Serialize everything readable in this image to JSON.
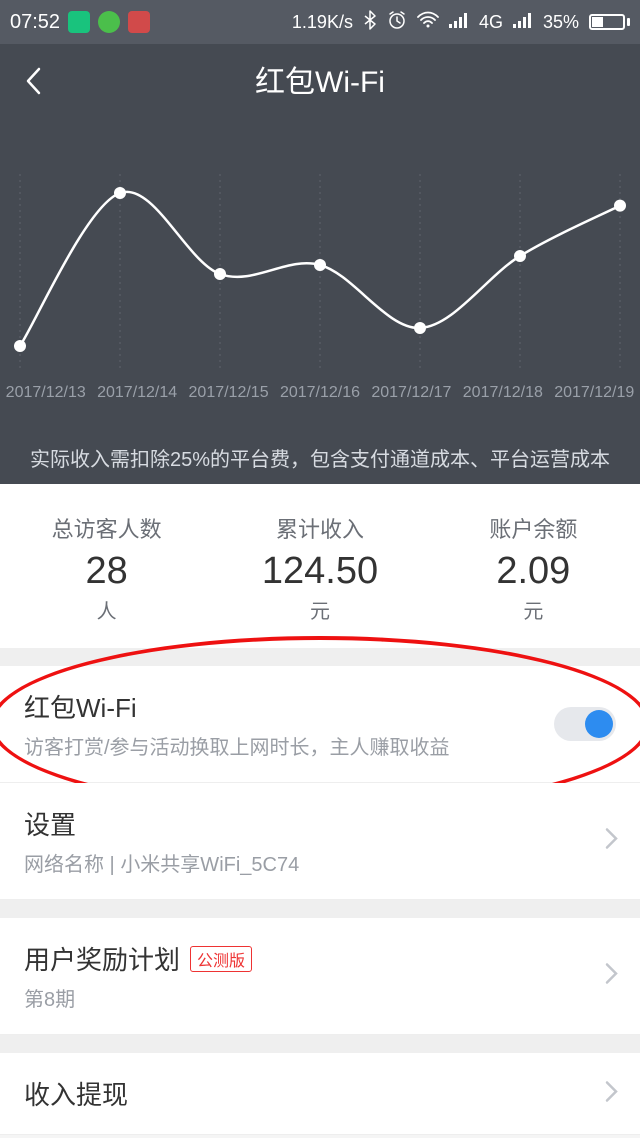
{
  "statusbar": {
    "time": "07:52",
    "throughput": "1.19K/s",
    "network": "4G",
    "battery_pct": "35%"
  },
  "header": {
    "title": "红包Wi-Fi",
    "note": "实际收入需扣除25%的平台费，包含支付通道成本、平台运营成本"
  },
  "chart_data": {
    "type": "line",
    "categories": [
      "2017/12/13",
      "2017/12/14",
      "2017/12/15",
      "2017/12/16",
      "2017/12/17",
      "2017/12/18",
      "2017/12/19"
    ],
    "values": [
      10,
      95,
      50,
      55,
      20,
      60,
      88
    ],
    "ylim": [
      0,
      100
    ],
    "ylabel": "",
    "xlabel": "",
    "title": ""
  },
  "stats": {
    "visitors": {
      "label": "总访客人数",
      "value": "28",
      "unit": "人"
    },
    "income": {
      "label": "累计收入",
      "value": "124.50",
      "unit": "元"
    },
    "balance": {
      "label": "账户余额",
      "value": "2.09",
      "unit": "元"
    }
  },
  "rows": {
    "hongbao": {
      "title": "红包Wi-Fi",
      "sub": "访客打赏/参与活动换取上网时长，主人赚取收益",
      "on": true
    },
    "settings": {
      "title": "设置",
      "sub_prefix": "网络名称 |  ",
      "ssid": "小米共享WiFi_5C74"
    },
    "reward": {
      "title": "用户奖励计划",
      "badge": "公测版",
      "sub": "第8期"
    },
    "withdraw": {
      "title": "收入提现"
    }
  }
}
